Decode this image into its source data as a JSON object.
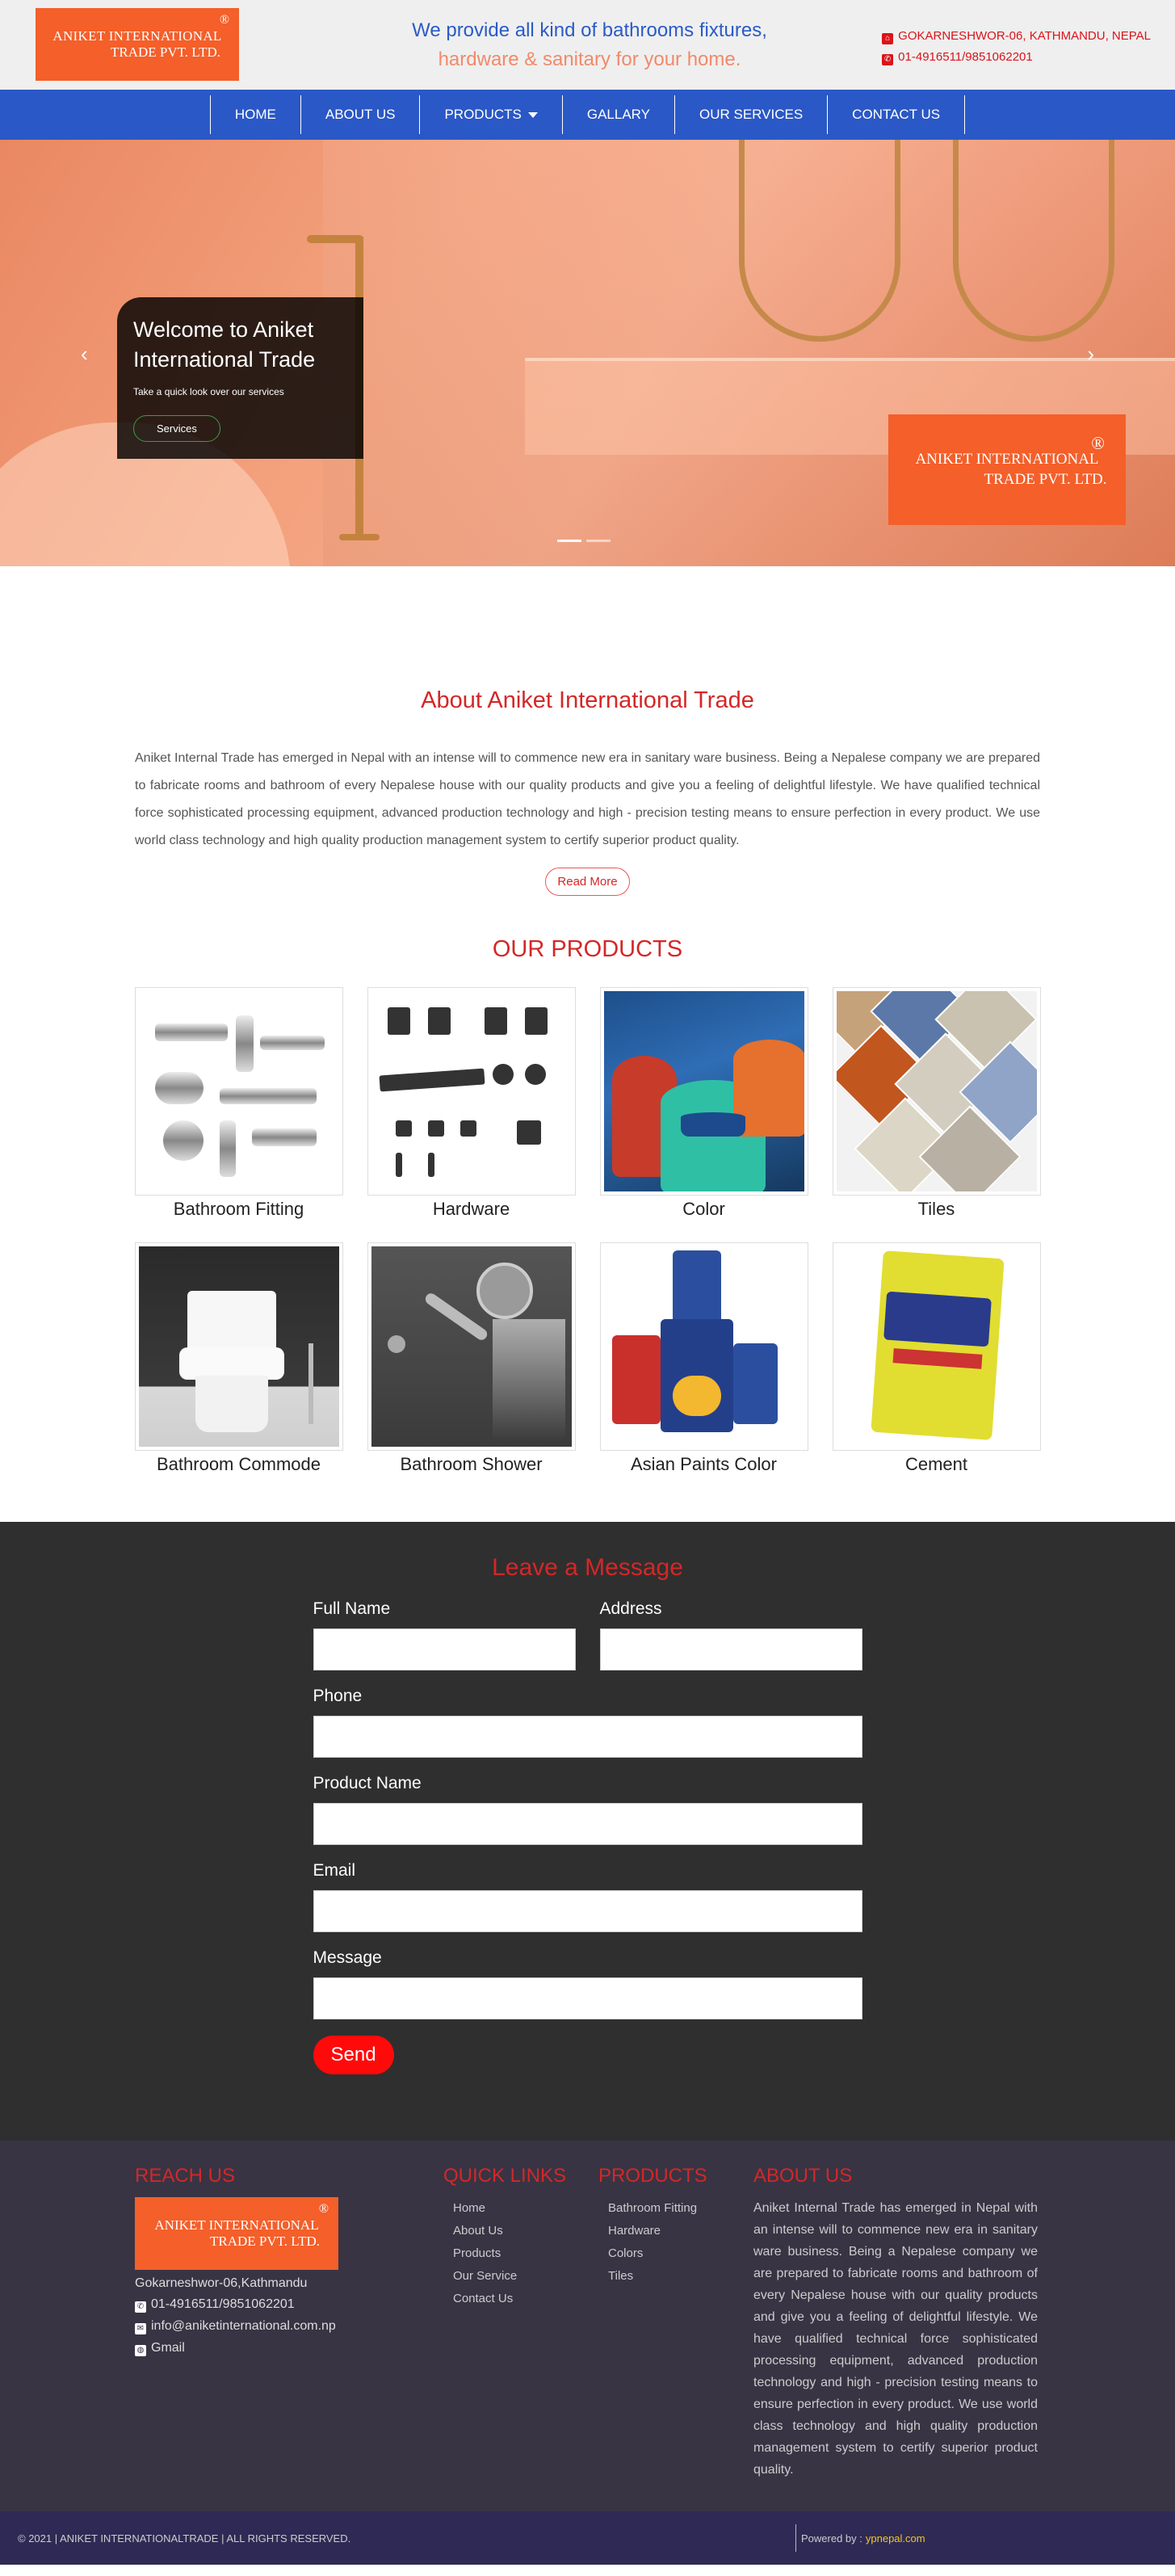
{
  "brand": {
    "logo_line1": "ANIKET INTERNATIONAL",
    "logo_line2": "TRADE PVT. LTD.",
    "registered": "®",
    "colors": {
      "logo_bg": "#f45f2a",
      "nav_bg": "#2a58c6",
      "accent_red": "#d42727"
    }
  },
  "header": {
    "tagline_line1": "We provide all kind of bathrooms fixtures,",
    "tagline_line2": "hardware & sanitary for your home.",
    "address": "GOKARNESHWOR-06, KATHMANDU, NEPAL",
    "phone": "01-4916511/9851062201",
    "address_icon": "map-marker-icon",
    "phone_icon": "phone-icon"
  },
  "nav": {
    "items": [
      {
        "label": "HOME"
      },
      {
        "label": "ABOUT US"
      },
      {
        "label": "PRODUCTS"
      },
      {
        "label": "GALLARY"
      },
      {
        "label": "OUR SERVICES"
      },
      {
        "label": "CONTACT US"
      }
    ]
  },
  "hero": {
    "title": "Welcome to Aniket International Trade",
    "subtitle": "Take a quick look over our services",
    "button": "Services",
    "prev_icon": "chevron-left-icon",
    "next_icon": "chevron-right-icon",
    "prev_glyph": "‹",
    "next_glyph": "›",
    "slide_count": 2,
    "active_slide": 1
  },
  "about": {
    "title": "About Aniket International Trade",
    "text": "Aniket Internal Trade has emerged in Nepal with an intense will to commence new era in sanitary ware business. Being a Nepalese company we are prepared to fabricate rooms and bathroom of every Nepalese house with our quality products and give you a feeling of delightful lifestyle. We have qualified technical force sophisticated processing equipment, advanced production technology and high - precision testing means to ensure perfection in every product. We use world class technology and high quality production management system to certify superior product quality.",
    "read_more": "Read More"
  },
  "products": {
    "title": "OUR PRODUCTS",
    "items": [
      {
        "name": "Bathroom Fitting"
      },
      {
        "name": "Hardware"
      },
      {
        "name": "Color"
      },
      {
        "name": "Tiles"
      },
      {
        "name": "Bathroom Commode"
      },
      {
        "name": "Bathroom Shower"
      },
      {
        "name": "Asian Paints Color"
      },
      {
        "name": "Cement"
      }
    ]
  },
  "message": {
    "title": "Leave a Message",
    "full_name": "Full Name",
    "address": "Address",
    "phone": "Phone",
    "product_name": "Product Name",
    "email": "Email",
    "message": "Message",
    "send": "Send"
  },
  "footer": {
    "reach": {
      "title": "REACH US",
      "location": "Gokarneshwor-06,Kathmandu",
      "phone": "01-4916511/9851062201",
      "email": "info@aniketinternational.com.np",
      "gmail": "Gmail",
      "phone_icon": "phone-icon",
      "email_icon": "envelope-icon",
      "globe_icon": "globe-icon"
    },
    "quick_links": {
      "title": "QUICK LINKS",
      "items": [
        {
          "label": "Home"
        },
        {
          "label": "About Us"
        },
        {
          "label": "Products"
        },
        {
          "label": "Our Service"
        },
        {
          "label": "Contact Us"
        }
      ]
    },
    "products": {
      "title": "PRODUCTS",
      "items": [
        {
          "label": "Bathroom Fitting"
        },
        {
          "label": "Hardware"
        },
        {
          "label": "Colors"
        },
        {
          "label": "Tiles"
        }
      ]
    },
    "about": {
      "title": "ABOUT US",
      "text": "Aniket Internal Trade has emerged in Nepal with an intense will to commence new era in sanitary ware business. Being a Nepalese company we are prepared to fabricate rooms and bathroom of every Nepalese house with our quality products and give you a feeling of delightful lifestyle. We have qualified technical force sophisticated processing equipment, advanced production technology and high - precision testing means to ensure perfection in every product. We use world class technology and high quality production management system to certify superior product quality."
    }
  },
  "bottom": {
    "copyright": "© 2021 | ANIKET INTERNATIONALTRADE | ALL RIGHTS RESERVED.",
    "powered_by": "Powered by :",
    "powered_link": "ypnepal.com"
  }
}
